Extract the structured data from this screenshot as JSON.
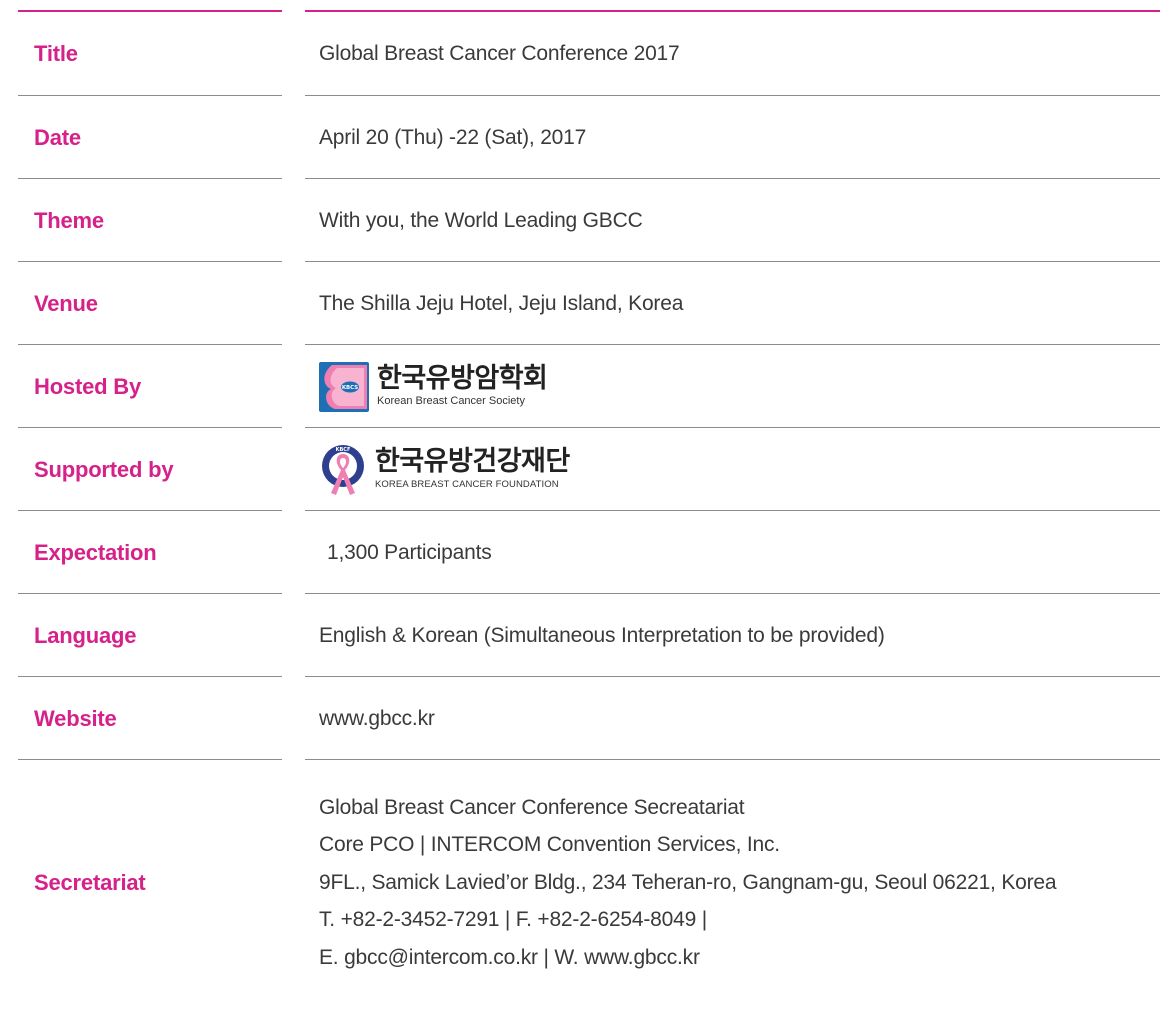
{
  "rows": [
    {
      "label": "Title",
      "value": "Global Breast Cancer Conference 2017"
    },
    {
      "label": "Date",
      "value": "April 20 (Thu) -22 (Sat), 2017"
    },
    {
      "label": "Theme",
      "value": "With you, the World Leading GBCC"
    },
    {
      "label": "Venue",
      "value": "The Shilla Jeju Hotel, Jeju Island, Korea"
    },
    {
      "label": "Hosted By",
      "logo": {
        "name_ko": "한국유방암학회",
        "name_en": "Korean Breast Cancer Society",
        "badge": "KBCS"
      }
    },
    {
      "label": "Supported by",
      "logo": {
        "name_ko": "한국유방건강재단",
        "name_en": "KOREA BREAST CANCER FOUNDATION",
        "ring_text": "KBCF"
      }
    },
    {
      "label": "Expectation",
      "value": "1,300 Participants"
    },
    {
      "label": "Language",
      "value": "English & Korean (Simultaneous Interpretation to be provided)"
    },
    {
      "label": "Website",
      "value": "www.gbcc.kr"
    },
    {
      "label": "Secretariat",
      "lines": [
        "Global Breast Cancer Conference Secreatariat",
        "Core PCO | INTERCOM Convention Services, Inc.",
        "9FL., Samick Lavied’or Bldg., 234 Teheran-ro, Gangnam-gu, Seoul 06221, Korea",
        "T. +82-2-3452-7291 | F. +82-2-6254-8049 |",
        "E. gbcc@intercom.co.kr | W. www.gbcc.kr"
      ]
    }
  ],
  "colors": {
    "accent": "#d6218a",
    "text": "#3a3a3a",
    "rule": "#8c8c8c",
    "logo_blue": "#1f6fb5",
    "logo_pink": "#f07fb1",
    "logo_navy": "#2e3f8f"
  }
}
